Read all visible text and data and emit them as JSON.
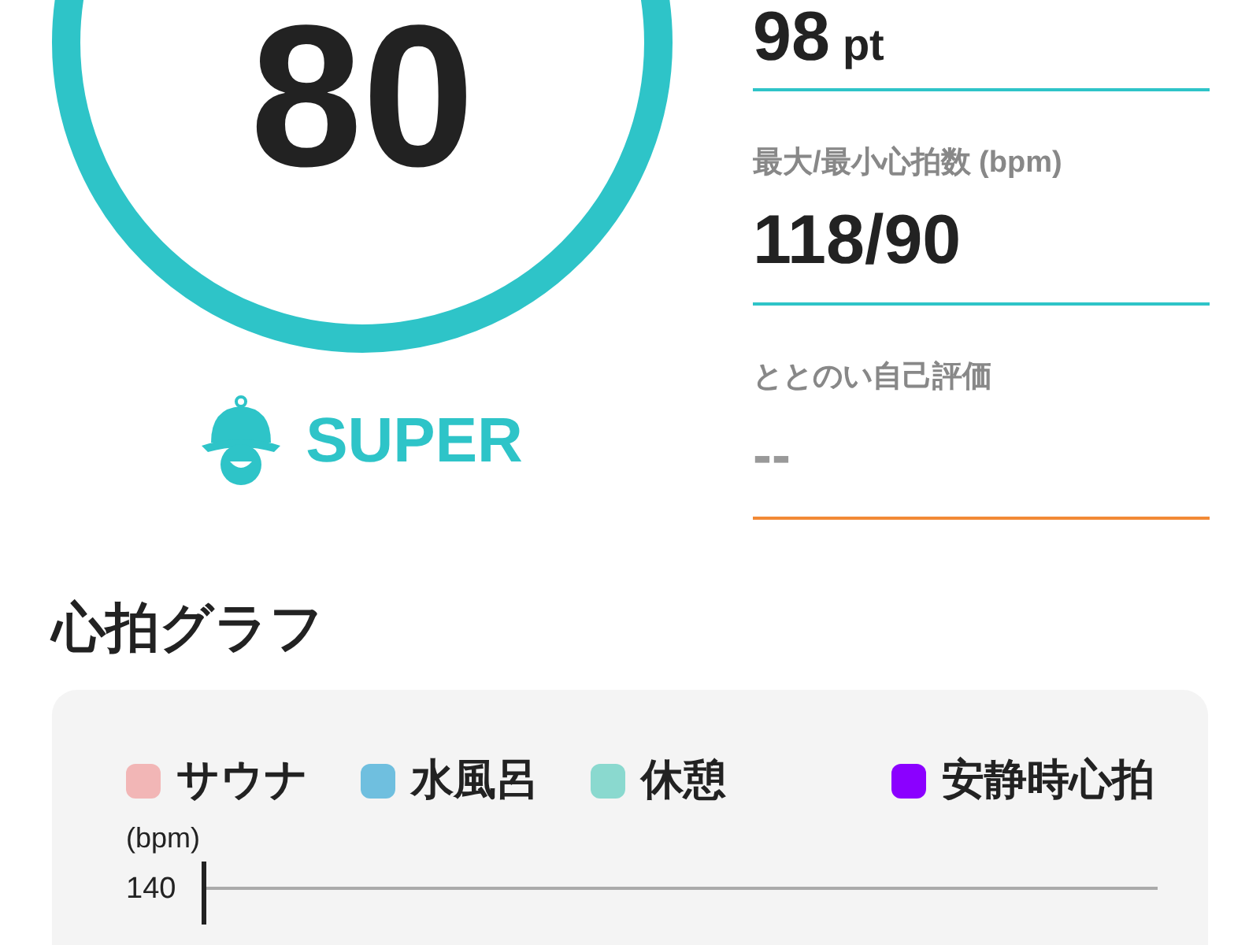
{
  "score": {
    "value": "80",
    "grade": "SUPER"
  },
  "stats": [
    {
      "value": "98",
      "unit": "pt",
      "color": "#2ec4c8"
    },
    {
      "label": "最大/最小心拍数 (bpm)",
      "value": "118/90",
      "color": "#2ec4c8"
    },
    {
      "label": "ととのい自己評価",
      "placeholder": "--",
      "color": "#f28a36"
    }
  ],
  "heart_rate_graph": {
    "title": "心拍グラフ",
    "legend": [
      {
        "label": "サウナ",
        "color": "#f2b6b6"
      },
      {
        "label": "水風呂",
        "color": "#6fbfdf"
      },
      {
        "label": "休憩",
        "color": "#8ad9cf"
      },
      {
        "label": "安静時心拍",
        "color": "#8b00ff"
      }
    ],
    "y_unit": "(bpm)",
    "y_ticks": [
      "140"
    ]
  }
}
